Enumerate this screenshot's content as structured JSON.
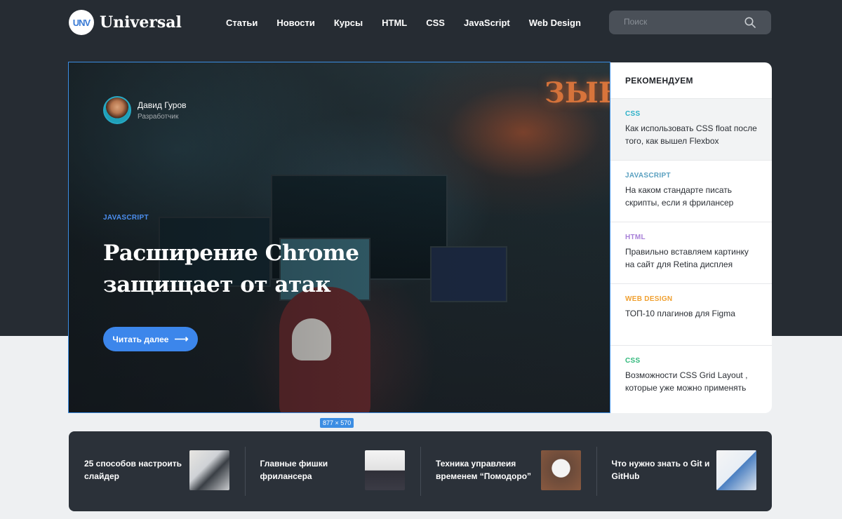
{
  "header": {
    "logo_mark": "UNV",
    "logo_text": "Universal",
    "nav": [
      "Статьи",
      "Новости",
      "Курсы",
      "HTML",
      "CSS",
      "JavaScript",
      "Web Design"
    ],
    "search_placeholder": "Поиск"
  },
  "hero": {
    "author_name": "Давид Гуров",
    "author_role": "Разработчик",
    "tag": "JAVASCRIPT",
    "title": "Расширение Chrome защищает от атак",
    "button_label": "Читать далее",
    "dimension_badge": "877 × 570"
  },
  "sidebar": {
    "heading": "РЕКОМЕНДУЕМ",
    "items": [
      {
        "tag": "CSS",
        "tag_color": "#2bb0c8",
        "title": "Как использовать CSS float после того, как вышел Flexbox"
      },
      {
        "tag": "JAVASCRIPT",
        "tag_color": "#5aa0c0",
        "title": "На каком стандарте писать скрипты, если я фрилансер"
      },
      {
        "tag": "HTML",
        "tag_color": "#a880d8",
        "title": "Правильно вставляем картинку на сайт для Retina дисплея"
      },
      {
        "tag": "WEB DESIGN",
        "tag_color": "#f0a030",
        "title": "ТОП-10 плагинов для Figma"
      },
      {
        "tag": "CSS",
        "tag_color": "#2fb87a",
        "title": "Возможности CSS Grid Layout , которые уже можно применять"
      }
    ]
  },
  "strip": [
    {
      "title": "25 способов настроить слайдер"
    },
    {
      "title": "Главные фишки фрилансера"
    },
    {
      "title": "Техника управлеия временем “Помодоро”"
    },
    {
      "title": "Что нужно знать о Git и GitHub"
    }
  ]
}
